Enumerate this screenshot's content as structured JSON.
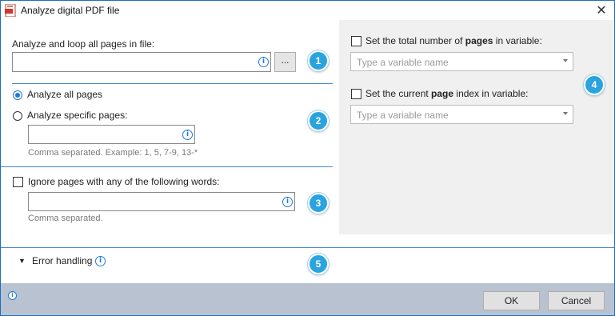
{
  "window": {
    "title": "Analyze digital PDF file",
    "close_glyph": "✕"
  },
  "loop": {
    "label": "Analyze and loop all pages in file:",
    "input_value": "",
    "browse_label": "...",
    "badge": "1"
  },
  "pages": {
    "all_label": "Analyze all pages",
    "specific_label": "Analyze specific pages:",
    "input_value": "",
    "hint": "Comma separated. Example: 1, 5, 7-9, 13-*",
    "badge": "2",
    "selected": "all"
  },
  "ignore": {
    "label": "Ignore pages with any of the following words:",
    "input_value": "",
    "hint": "Comma separated.",
    "badge": "3",
    "checked": false
  },
  "right": {
    "total": {
      "pre": "Set the total number of ",
      "bold": "pages",
      "post": " in variable:",
      "placeholder": "Type a variable name",
      "checked": false
    },
    "current": {
      "pre": "Set the current ",
      "bold": "page",
      "post": " index in variable:",
      "placeholder": "Type a variable name",
      "checked": false
    },
    "badge": "4"
  },
  "error": {
    "label": "Error handling",
    "badge": "5"
  },
  "footer": {
    "ok_label": "OK",
    "cancel_label": "Cancel"
  },
  "colors": {
    "accent": "#1f7ad8",
    "badge": "#2aa3df",
    "footer_bg": "#b8c2d0",
    "panel_bg": "#f0f0f0",
    "border": "#1e6fb8"
  },
  "icons": [
    "pdf-app-icon",
    "info-icon",
    "chevron-down-icon",
    "close-icon"
  ]
}
